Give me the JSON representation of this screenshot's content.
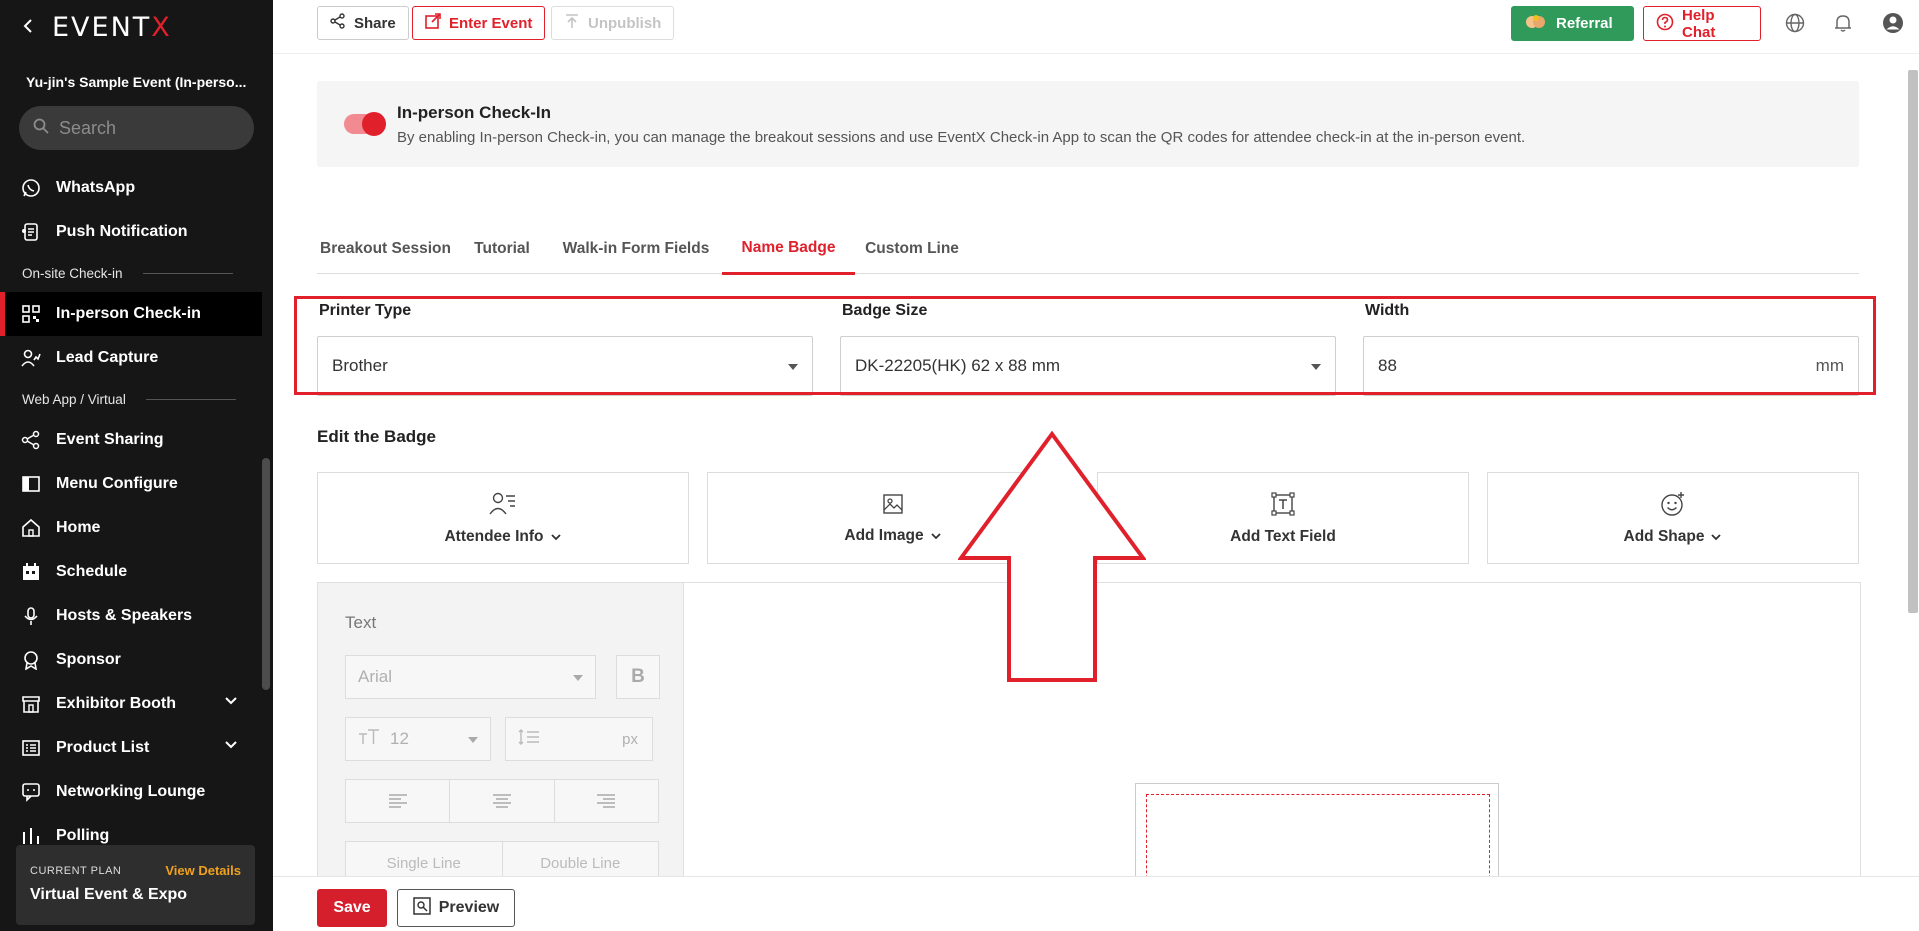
{
  "app": {
    "logo_prefix": "EVENT",
    "logo_x": "X",
    "event_name": "Yu-jin's Sample Event (In-perso..."
  },
  "sidebar": {
    "search_placeholder": "Search",
    "items": [
      {
        "label": "WhatsApp",
        "icon": "whatsapp-icon"
      },
      {
        "label": "Push Notification",
        "icon": "push-notification-icon"
      },
      {
        "section": "On-site Check-in"
      },
      {
        "label": "In-person Check-in",
        "icon": "qr-code-icon",
        "active": true
      },
      {
        "label": "Lead Capture",
        "icon": "lead-capture-icon"
      },
      {
        "section": "Web App / Virtual"
      },
      {
        "label": "Event Sharing",
        "icon": "share-icon"
      },
      {
        "label": "Menu Configure",
        "icon": "menu-configure-icon"
      },
      {
        "label": "Home",
        "icon": "home-icon"
      },
      {
        "label": "Schedule",
        "icon": "calendar-icon"
      },
      {
        "label": "Hosts & Speakers",
        "icon": "microphone-icon"
      },
      {
        "label": "Sponsor",
        "icon": "sponsor-icon"
      },
      {
        "label": "Exhibitor Booth",
        "icon": "booth-icon",
        "expandable": true
      },
      {
        "label": "Product List",
        "icon": "product-list-icon",
        "expandable": true
      },
      {
        "label": "Networking Lounge",
        "icon": "chat-icon"
      },
      {
        "label": "Polling",
        "icon": "polling-icon"
      }
    ],
    "plan": {
      "label": "CURRENT PLAN",
      "link": "View Details",
      "name": "Virtual Event & Expo"
    }
  },
  "topbar": {
    "share": "Share",
    "enter_event": "Enter Event",
    "unpublish": "Unpublish",
    "referral": "Referral",
    "help_chat": "Help Chat"
  },
  "checkin": {
    "enabled": true,
    "title": "In-person Check-In",
    "description": "By enabling In-person Check-in, you can manage the breakout sessions and use EventX Check-in App to scan the QR codes for attendee check-in at the in-person event."
  },
  "tabs": [
    {
      "label": "Breakout Session"
    },
    {
      "label": "Tutorial"
    },
    {
      "label": "Walk-in Form Fields"
    },
    {
      "label": "Name Badge",
      "active": true
    },
    {
      "label": "Custom Line"
    }
  ],
  "badge_settings": {
    "printer_type_label": "Printer Type",
    "printer_type_value": "Brother",
    "badge_size_label": "Badge Size",
    "badge_size_value": "DK-22205(HK) 62 x 88 mm",
    "width_label": "Width",
    "width_value": "88",
    "width_unit": "mm"
  },
  "edit_badge": {
    "title": "Edit the Badge",
    "cards": [
      {
        "label": "Attendee Info",
        "dropdown": true,
        "icon": "attendee-info-icon"
      },
      {
        "label": "Add Image",
        "dropdown": true,
        "icon": "image-icon"
      },
      {
        "label": "Add Text Field",
        "dropdown": false,
        "icon": "text-field-icon"
      },
      {
        "label": "Add Shape",
        "dropdown": true,
        "icon": "shape-icon"
      }
    ],
    "text_panel": {
      "label": "Text",
      "font": "Arial",
      "font_size": "12",
      "line_height_unit": "px",
      "bold": "B",
      "single_line": "Single Line",
      "double_line": "Double Line"
    }
  },
  "bottombar": {
    "save": "Save",
    "preview": "Preview"
  },
  "colors": {
    "accent": "#e0202b",
    "sidebar_bg": "#161616",
    "referral_bg": "#2f9a59",
    "plan_link": "#f0a21e"
  }
}
